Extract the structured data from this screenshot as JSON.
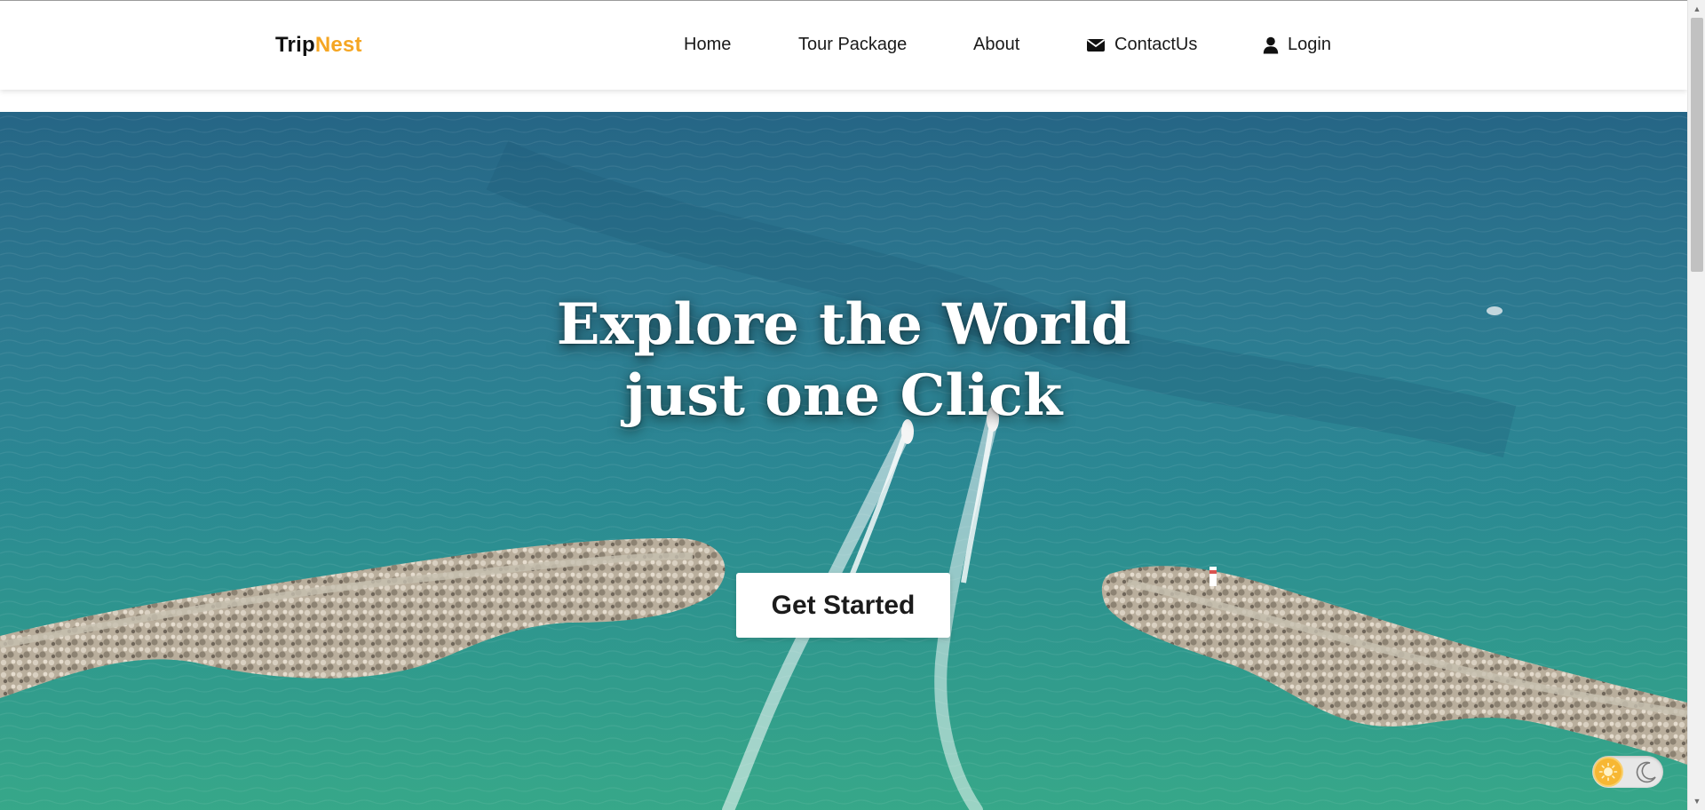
{
  "header": {
    "brand_part1": "Trip",
    "brand_part2": "Nest",
    "nav": {
      "home": "Home",
      "tour": "Tour Package",
      "about": "About",
      "contact": "ContactUs",
      "login": "Login"
    }
  },
  "hero": {
    "title_line1": "Explore the World",
    "title_line2": "just one Click",
    "cta_label": "Get Started"
  },
  "theme_toggle": {
    "light_icon": "sun-icon",
    "dark_icon": "moon-icon",
    "selected": "light"
  },
  "icons": {
    "contact": "envelope-icon",
    "login": "user-icon"
  },
  "colors": {
    "brand_accent": "#f5a623",
    "nav_text": "#1a1a1a",
    "cta_background": "#ffffff",
    "hero_text": "#ffffff"
  }
}
